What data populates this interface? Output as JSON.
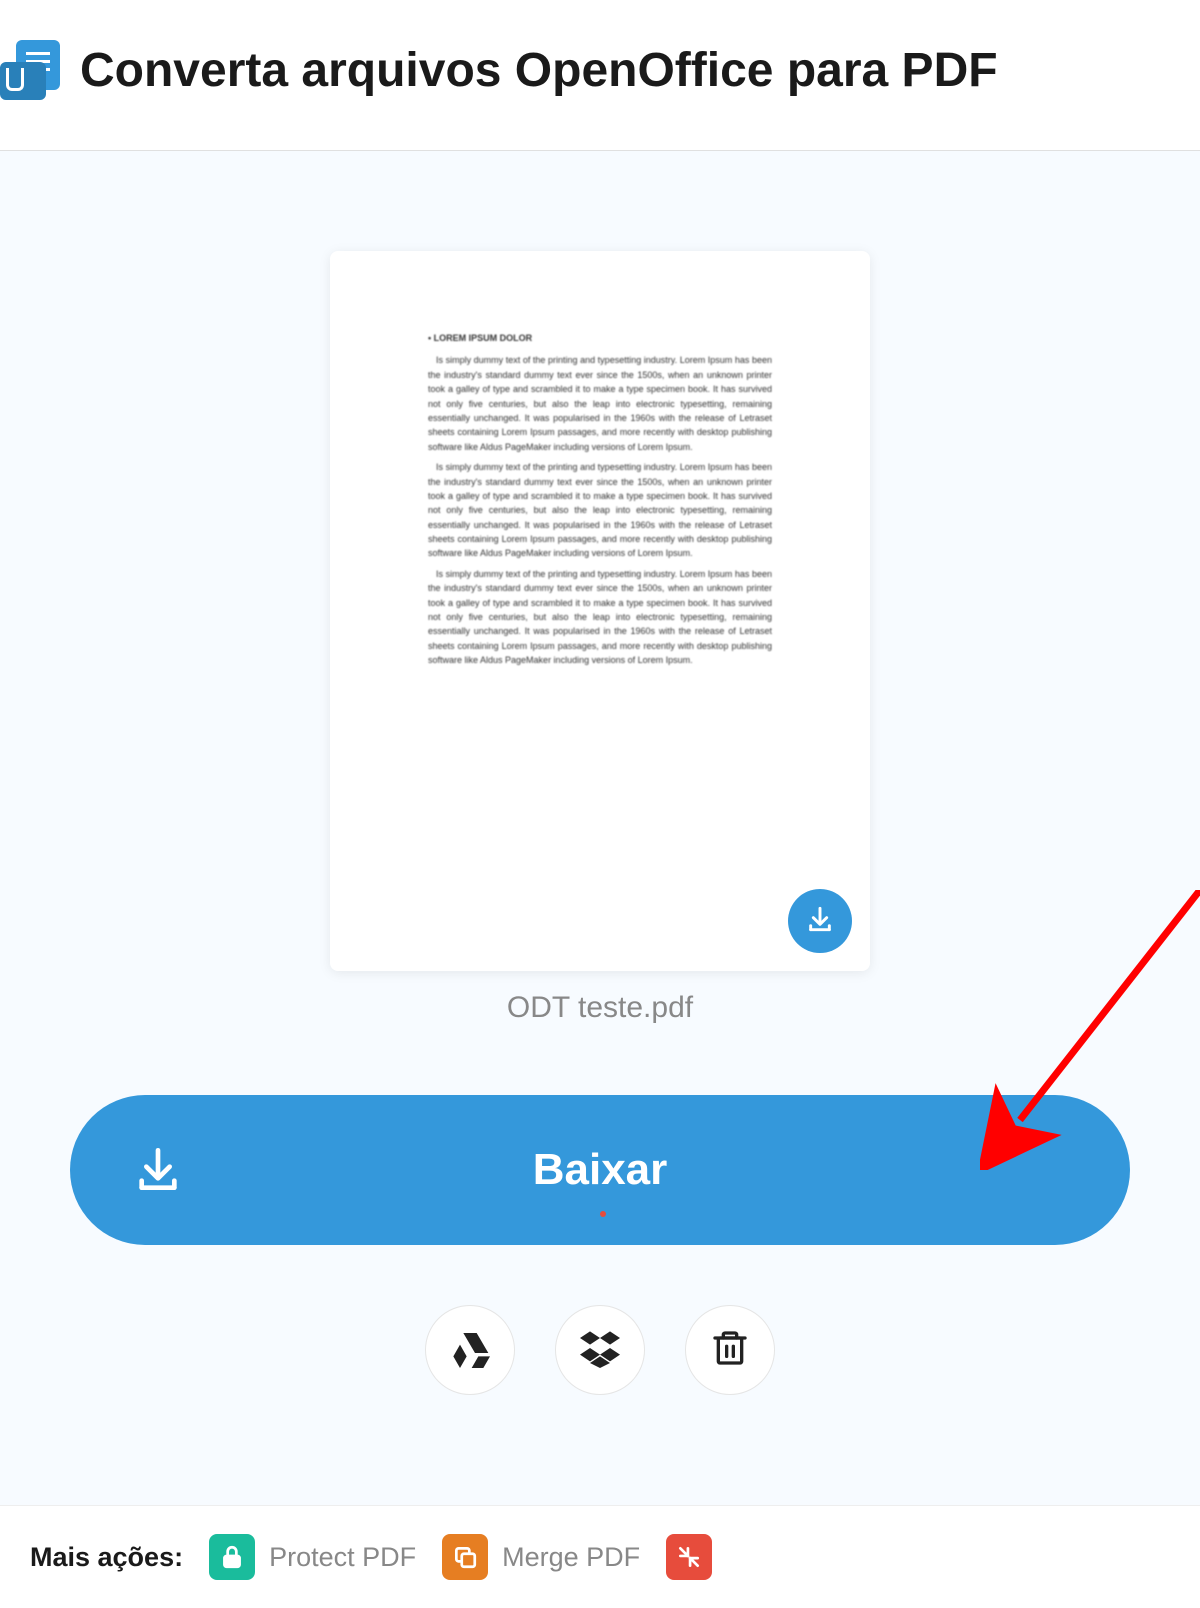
{
  "header": {
    "title": "Converta arquivos OpenOffice para PDF"
  },
  "preview": {
    "filename": "ODT teste.pdf"
  },
  "download_button": {
    "label": "Baixar"
  },
  "more_actions": {
    "label": "Mais ações:",
    "protect": "Protect PDF",
    "merge": "Merge PDF"
  }
}
